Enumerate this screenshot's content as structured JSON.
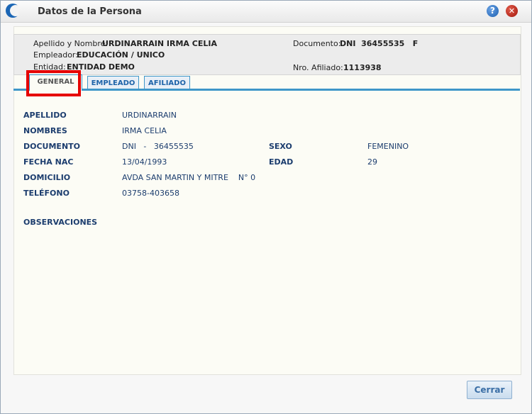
{
  "window": {
    "title": "Datos de la Persona"
  },
  "summary": {
    "name_label": "Apellido y Nombre:",
    "name_value": "URDINARRAIN IRMA CELIA",
    "employer_label": "Empleador:",
    "employer_value": "EDUCACIÓN / UNICO",
    "entity_label": "Entidad:",
    "entity_value": "ENTIDAD DEMO",
    "document_label": "Documento:",
    "document_value": "DNI  36455535   F",
    "affiliate_label": "Nro. Afiliado:",
    "affiliate_value": "1113938"
  },
  "tabs": [
    {
      "label": "GENERAL",
      "active": true
    },
    {
      "label": "EMPLEADO",
      "active": false
    },
    {
      "label": "AFILIADO",
      "active": false
    }
  ],
  "fields": {
    "apellido_label": "APELLIDO",
    "apellido_value": "URDINARRAIN",
    "nombres_label": "NOMBRES",
    "nombres_value": "IRMA CELIA",
    "documento_label": "DOCUMENTO",
    "documento_value": "DNI   -   36455535",
    "sexo_label": "SEXO",
    "sexo_value": "FEMENINO",
    "fecha_label": "FECHA NAC",
    "fecha_value": "13/04/1993",
    "edad_label": "EDAD",
    "edad_value": "29",
    "domicilio_label": "DOMICILIO",
    "domicilio_value": "AVDA SAN MARTIN Y MITRE    N° 0",
    "telefono_label": "TELÉFONO",
    "telefono_value": "03758-403658",
    "observaciones_label": "OBSERVACIONES"
  },
  "buttons": {
    "close_label": "Cerrar"
  },
  "icons": {
    "help": "help-icon",
    "close": "close-icon"
  },
  "colors": {
    "accent": "#3f97c9",
    "highlight": "#e60000",
    "label_text": "#1c3d6e"
  }
}
